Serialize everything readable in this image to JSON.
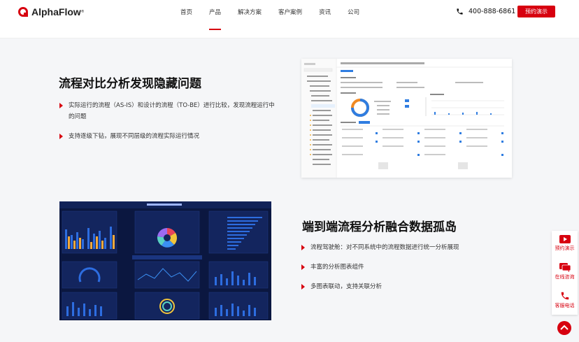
{
  "brand": {
    "name": "AlphaFlow",
    "accent": "#d7000f"
  },
  "nav": {
    "items": [
      "首页",
      "产品",
      "解决方案",
      "客户案例",
      "资讯",
      "公司"
    ],
    "active_index": 1,
    "phone": "400-888-6861",
    "cta": "预约演示"
  },
  "section1": {
    "title": "流程对比分析发现隐藏问题",
    "bullets": [
      "实际运行的流程（AS-IS）和设计的流程（TO-BE）进行比较，发现流程运行中的问题",
      "支持逐级下钻，展现不同层级的流程实际运行情况"
    ]
  },
  "section2": {
    "title": "端到端流程分析融合数据孤岛",
    "bullets": [
      "流程驾驶舱：对不同系统中的流程数据进行统一分析展现",
      "丰富的分析图表组件",
      "多图表联动，支持关联分析"
    ]
  },
  "side_widget": {
    "items": [
      {
        "label": "预约演示",
        "icon": "play-icon"
      },
      {
        "label": "在线咨询",
        "icon": "chat-icon"
      },
      {
        "label": "客服电话",
        "icon": "phone-icon"
      }
    ],
    "top_icon": "arrow-up-icon"
  }
}
